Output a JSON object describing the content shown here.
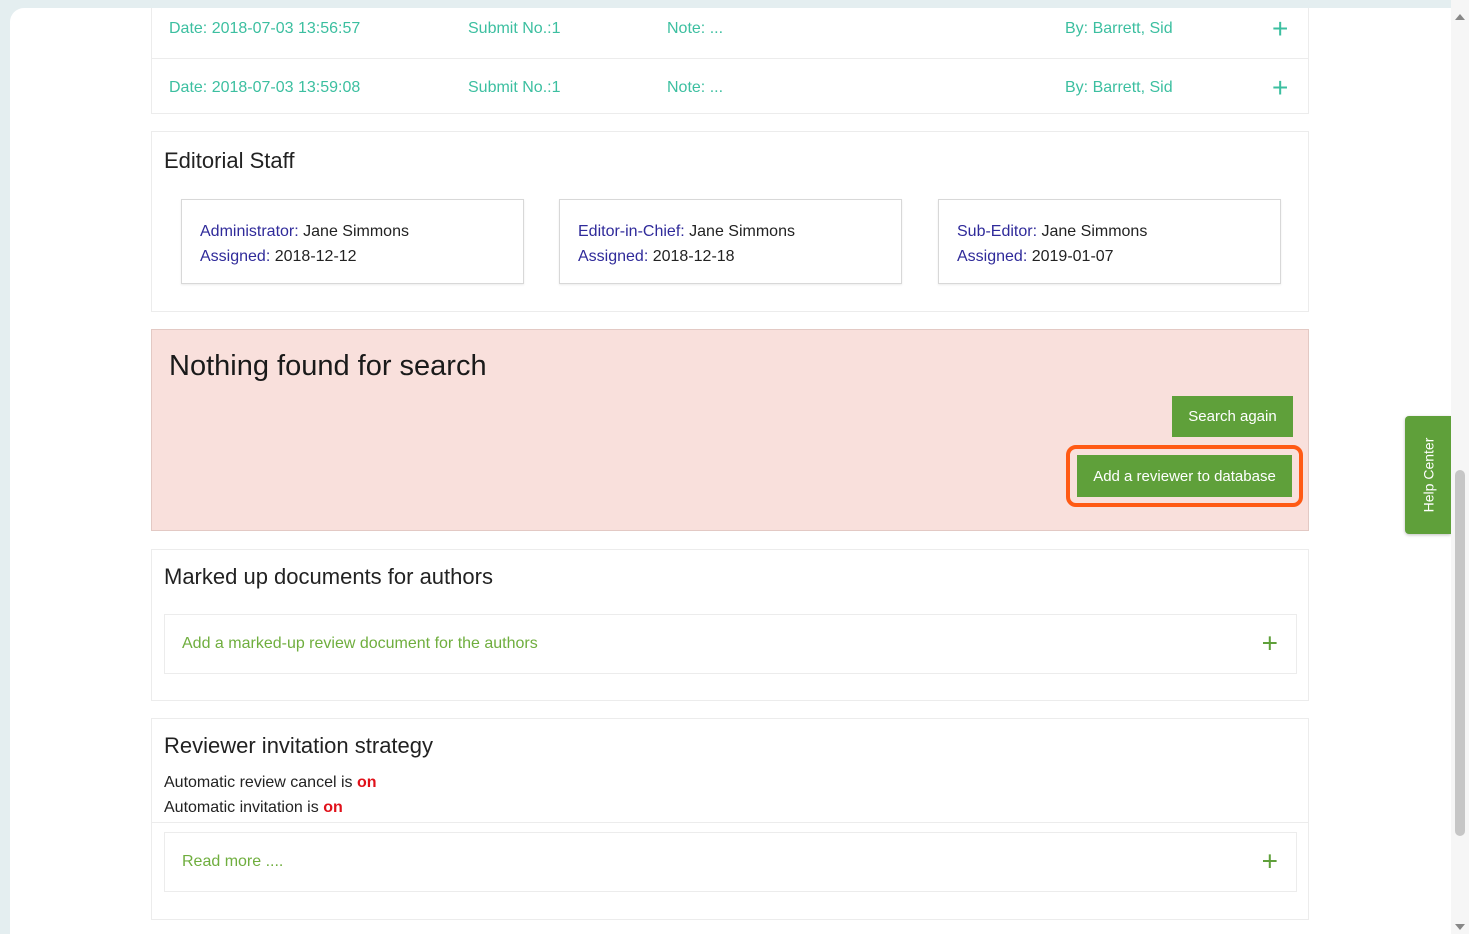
{
  "history": {
    "rows": [
      {
        "date": "Date: 2018-07-03 13:56:57",
        "submit": "Submit No.:1",
        "note": "Note: ...",
        "by": "By: Barrett, Sid",
        "expand": "+"
      },
      {
        "date": "Date: 2018-07-03 13:59:08",
        "submit": "Submit No.:1",
        "note": "Note: ...",
        "by": "By: Barrett, Sid",
        "expand": "+"
      }
    ]
  },
  "editorial_staff": {
    "title": "Editorial Staff",
    "cards": [
      {
        "role_label": "Administrator:",
        "name": "Jane Simmons",
        "assigned_label": "Assigned:",
        "assigned_date": "2018-12-12"
      },
      {
        "role_label": "Editor-in-Chief:",
        "name": "Jane Simmons",
        "assigned_label": "Assigned:",
        "assigned_date": "2018-12-18"
      },
      {
        "role_label": "Sub-Editor:",
        "name": "Jane Simmons",
        "assigned_label": "Assigned:",
        "assigned_date": "2019-01-07"
      }
    ]
  },
  "search_result": {
    "title": "Nothing found for search",
    "search_again_label": "Search again",
    "add_reviewer_label": "Add a reviewer to database"
  },
  "marked_up": {
    "title": "Marked up documents for authors",
    "add_link": "Add a marked-up review document for the authors",
    "expand": "+"
  },
  "strategy": {
    "title": "Reviewer invitation strategy",
    "cancel_text": "Automatic review cancel is",
    "cancel_state": "on",
    "invitation_text": "Automatic invitation is",
    "invitation_state": "on",
    "read_more": "Read more ....",
    "expand": "+"
  },
  "help_center": {
    "label": "Help Center"
  },
  "colors": {
    "accent_green": "#5fa03a",
    "teal_text": "#3cbfa0",
    "alert_bg": "#f9e0dc",
    "highlight_orange": "#ff5a14",
    "status_on_red": "#e0111a",
    "label_purple": "#2f2a9a"
  }
}
